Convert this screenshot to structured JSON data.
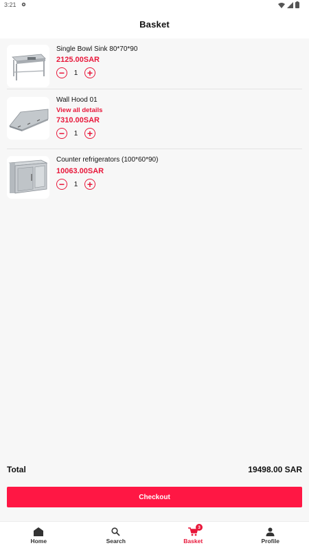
{
  "statusbar": {
    "time": "3:21"
  },
  "header": {
    "title": "Basket"
  },
  "items": [
    {
      "name": "Single Bowl Sink 80*70*90",
      "price": "2125.00SAR",
      "quantity": "1",
      "details_link": ""
    },
    {
      "name": "Wall Hood 01",
      "price": "7310.00SAR",
      "quantity": "1",
      "details_link": "View all details"
    },
    {
      "name": "Counter refrigerators (100*60*90)",
      "price": "10063.00SAR",
      "quantity": "1",
      "details_link": ""
    }
  ],
  "summary": {
    "total_label": "Total",
    "total_value": "19498.00 SAR"
  },
  "checkout_label": "Checkout",
  "nav": {
    "home": "Home",
    "search": "Search",
    "basket": "Basket",
    "basket_badge": "3",
    "profile": "Profile"
  },
  "colors": {
    "accent": "#e8173a",
    "checkout_bg": "#ff1744"
  }
}
